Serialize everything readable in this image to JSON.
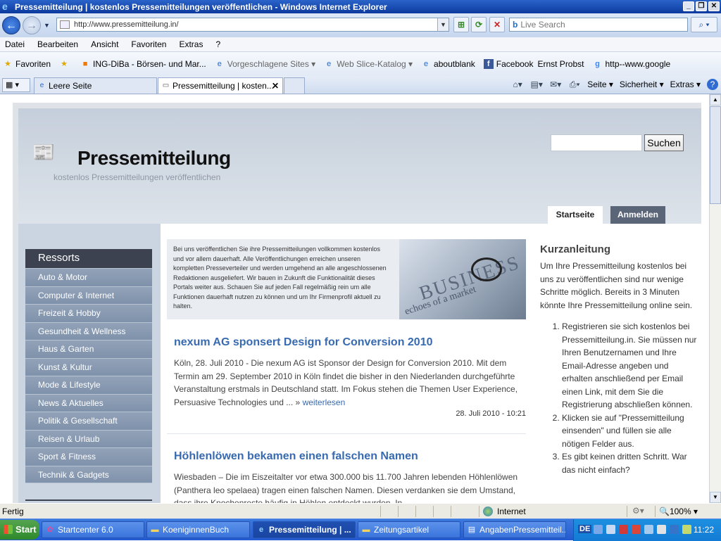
{
  "window": {
    "title": "Pressemitteilung | kostenlos Pressemitteilungen veröffentlichen - Windows Internet Explorer"
  },
  "address_bar": {
    "url": "http://www.pressemitteilung.in/",
    "search_placeholder": "Live Search"
  },
  "menu": [
    "Datei",
    "Bearbeiten",
    "Ansicht",
    "Favoriten",
    "Extras",
    "?"
  ],
  "favorites_bar": {
    "favorites_label": "Favoriten",
    "items": [
      {
        "label": "ING-DiBa - Börsen- und Mar...",
        "dimmed": false
      },
      {
        "label": "Vorgeschlagene Sites ▾",
        "dimmed": true
      },
      {
        "label": "Web Slice-Katalog ▾",
        "dimmed": true
      },
      {
        "label": "aboutblank",
        "dimmed": false
      },
      {
        "label": "Facebook",
        "dimmed": false
      },
      {
        "label": "Ernst Probst",
        "dimmed": false
      },
      {
        "label": "http--www.google",
        "dimmed": false
      }
    ]
  },
  "tabs": [
    {
      "label": "Leere Seite",
      "active": false
    },
    {
      "label": "Pressemitteilung | kosten...",
      "active": true
    }
  ],
  "command_bar": {
    "page": "Seite ▾",
    "security": "Sicherheit ▾",
    "tools": "Extras ▾"
  },
  "site": {
    "title": "Pressemitteilung",
    "tagline": "kostenlos Pressemitteilungen veröffentlichen",
    "search_button": "Suchen",
    "nav": {
      "home": "Startseite",
      "login": "Anmelden"
    },
    "sidebar": {
      "heading": "Ressorts",
      "categories": [
        "Auto & Motor",
        "Computer & Internet",
        "Freizeit & Hobby",
        "Gesundheit & Wellness",
        "Haus & Garten",
        "Kunst & Kultur",
        "Mode & Lifestyle",
        "News & Aktuelles",
        "Politik & Gesellschaft",
        "Reisen & Urlaub",
        "Sport & Fitness",
        "Technik & Gadgets"
      ]
    },
    "intro": "Bei uns veröffentlichen Sie ihre Pressemitteilungen vollkommen kostenlos und vor allem dauerhaft. Alle Veröffentlichungen erreichen unseren kompletten Presseverteiler und werden umgehend an alle angeschlossenen Redaktionen ausgeliefert. Wir bauen in Zukunft die Funktionalität dieses Portals weiter aus. Schauen Sie auf jeden Fall regelmäßig rein um alle Funktionen dauerhaft nutzen zu können und um Ihr Firmenprofil aktuell zu halten.",
    "banner": {
      "word": "BUSINESS",
      "sub": "echoes of a market"
    },
    "articles": [
      {
        "title": "nexum AG sponsert Design for Conversion 2010",
        "text": "Köln, 28. Juli 2010 - Die nexum AG ist Sponsor der Design for Conversion 2010. Mit dem Termin am 29. September 2010 in Köln findet die bisher in den Niederlanden durchgeführte Veranstaltung erstmals in Deutschland statt. Im Fokus stehen die Themen User Experience, Persuasive Technologies und ... »",
        "more": "weiterlesen",
        "date": "28. Juli 2010 - 10:21"
      },
      {
        "title": "Höhlenlöwen bekamen einen falschen Namen",
        "text": "Wiesbaden – Die im Eiszeitalter vor etwa 300.000 bis 11.700 Jahren lebenden Höhlenlöwen (Panthera leo spelaea) tragen einen falschen Namen. Diesen verdanken sie dem Umstand, dass ihre Knochenreste häufig in Höhlen entdeckt wurden. In"
      }
    ],
    "quick_guide": {
      "heading": "Kurzanleitung",
      "text": "Um Ihre Pressemitteilung kostenlos bei uns zu veröffentlichen sind nur wenige Schritte möglich. Bereits in 3 Minuten könnte Ihre Pressemitteilung online sein.",
      "steps": [
        "Registrieren sie sich kostenlos bei Pressemitteilung.in. Sie müssen nur Ihren Benutzernamen und Ihre Email-Adresse angeben und erhalten anschließend per Email einen Link, mit dem Sie die Registrierung abschließen können.",
        "Klicken sie auf \"Pressemitteilung einsenden\" und füllen sie alle nötigen Felder aus.",
        "Es gibt keinen dritten Schritt. War das nicht einfach?"
      ]
    }
  },
  "status_bar": {
    "status": "Fertig",
    "zone": "Internet",
    "zoom": "100%"
  },
  "taskbar": {
    "start": "Start",
    "tasks": [
      {
        "label": "Startcenter 6.0",
        "active": false
      },
      {
        "label": "KoeniginnenBuch",
        "active": false
      },
      {
        "label": "Pressemitteilung | ...",
        "active": true
      },
      {
        "label": "Zeitungsartikel",
        "active": false
      },
      {
        "label": "AngabenPressemitteil...",
        "active": false
      }
    ],
    "lang": "DE",
    "clock": "11:22"
  }
}
